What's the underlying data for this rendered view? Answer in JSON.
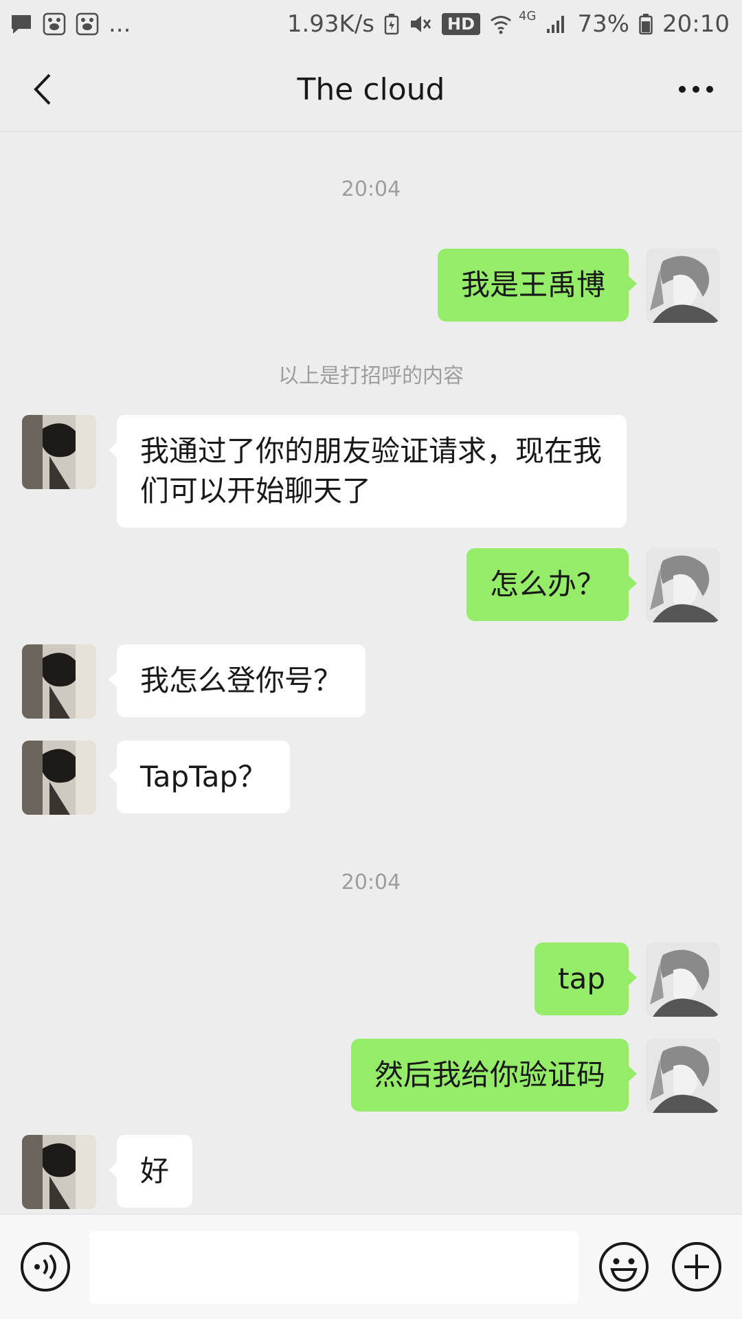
{
  "status_bar": {
    "notifications": [
      "message-icon",
      "baidu-icon",
      "baidu-icon"
    ],
    "more": "...",
    "speed": "1.93K/s",
    "hd": "HD",
    "network": "4G",
    "battery": "73%",
    "time": "20:10"
  },
  "nav": {
    "title": "The cloud"
  },
  "messages": [
    {
      "type": "time",
      "text": "20:04"
    },
    {
      "type": "out",
      "text": "我是王禹博"
    },
    {
      "type": "system",
      "text": "以上是打招呼的内容"
    },
    {
      "type": "in",
      "text": "我通过了你的朋友验证请求，现在我们可以开始聊天了"
    },
    {
      "type": "out",
      "text": "怎么办？"
    },
    {
      "type": "in",
      "text": "我怎么登你号？"
    },
    {
      "type": "in",
      "text": "TapTap？"
    },
    {
      "type": "time",
      "text": "20:04"
    },
    {
      "type": "out",
      "text": "tap"
    },
    {
      "type": "out",
      "text": "然后我给你验证码"
    },
    {
      "type": "in",
      "text": "好"
    }
  ],
  "input": {
    "value": "",
    "placeholder": ""
  },
  "colors": {
    "background": "#ededed",
    "bubble_out": "#95ec69",
    "bubble_in": "#ffffff"
  }
}
